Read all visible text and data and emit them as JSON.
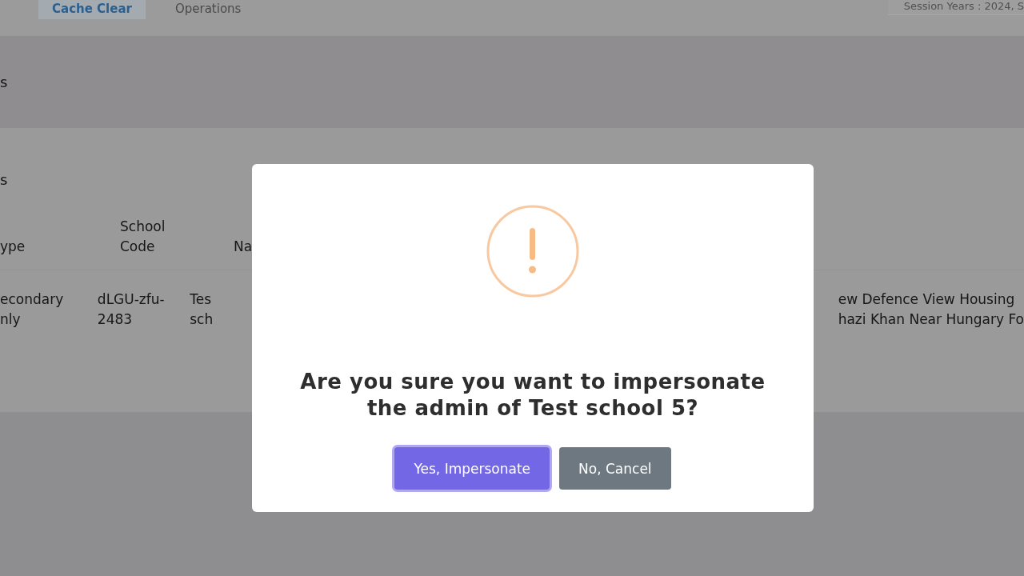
{
  "top_tabs": [
    {
      "label": "Cache Clear",
      "selected": true
    },
    {
      "label": "Operations",
      "selected": false
    }
  ],
  "session_years": "Session Years : 2024, S",
  "sections": [
    {
      "title": "s"
    },
    {
      "title": "s"
    }
  ],
  "table": {
    "columns": [
      "ype",
      "School\nCode",
      "Na"
    ],
    "rows": [
      {
        "cells": [
          "econdary\nnly",
          "dLGU-zfu-\n2483",
          "Tes\nsch"
        ],
        "address": "ew Defence View Housing\nhazi Khan Near Hungary Fo"
      }
    ]
  },
  "dialog": {
    "kind": "warning",
    "title": "Are you sure you want to impersonate the admin of Test school 5?",
    "buttons": [
      {
        "label": "Yes, Impersonate",
        "kind": "confirm",
        "focused": true
      },
      {
        "label": "No, Cancel",
        "kind": "cancel",
        "focused": false
      }
    ]
  }
}
